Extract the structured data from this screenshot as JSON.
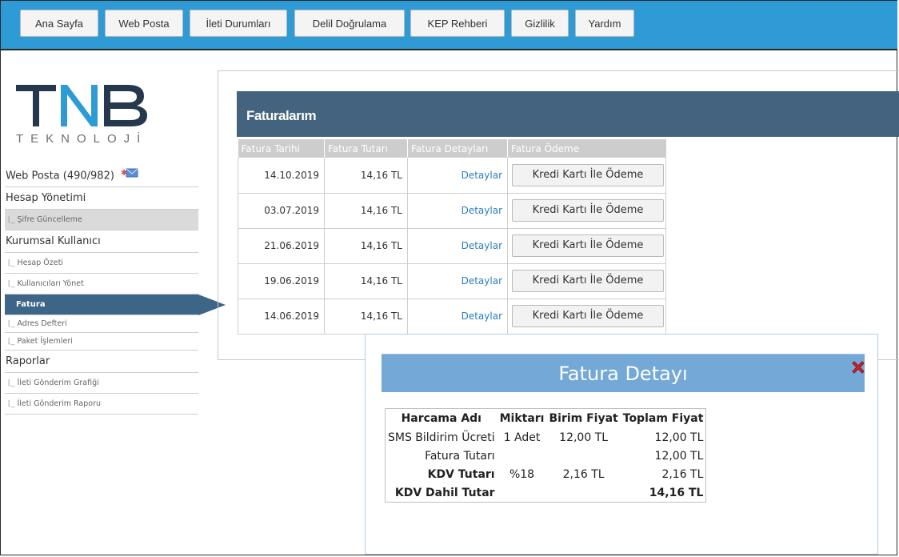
{
  "nav": {
    "items": [
      "Ana Sayfa",
      "Web Posta",
      "İleti Durumları",
      "Delil Doğrulama",
      "KEP Rehberi",
      "Gizlilik",
      "Yardım"
    ]
  },
  "logo": {
    "main": "TNB",
    "sub": "TEKNOLOJİ"
  },
  "sidebar": {
    "webposta": "Web Posta (490/982)",
    "hesap_yonetimi": "Hesap Yönetimi",
    "sifre": "Şifre Güncelleme",
    "kurumsal": "Kurumsal Kullanıcı",
    "hesap_ozeti": "Hesap Özeti",
    "kullanicilar": "Kullanıcıları Yönet",
    "fatura": "Fatura",
    "adres": "Adres Defteri",
    "paket": "Paket İşlemleri",
    "raporlar": "Raporlar",
    "grafik": "İleti Gönderim Grafiği",
    "rapor": "İleti Gönderim Raporu"
  },
  "invoices": {
    "title": "Faturalarım",
    "headers": [
      "Fatura Tarihi",
      "Fatura Tutarı",
      "Fatura Detayları",
      "Fatura Ödeme"
    ],
    "rows": [
      {
        "date": "14.10.2019",
        "amount": "14,16 TL",
        "details": "Detaylar",
        "pay": "Kredi Kartı İle Ödeme"
      },
      {
        "date": "03.07.2019",
        "amount": "14,16 TL",
        "details": "Detaylar",
        "pay": "Kredi Kartı İle Ödeme"
      },
      {
        "date": "21.06.2019",
        "amount": "14,16 TL",
        "details": "Detaylar",
        "pay": "Kredi Kartı İle Ödeme"
      },
      {
        "date": "19.06.2019",
        "amount": "14,16 TL",
        "details": "Detaylar",
        "pay": "Kredi Kartı İle Ödeme"
      },
      {
        "date": "14.06.2019",
        "amount": "14,16 TL",
        "details": "Detaylar",
        "pay": "Kredi Kartı İle Ödeme"
      }
    ]
  },
  "modal": {
    "title": "Fatura Detayı",
    "headers": [
      "Harcama Adı",
      "Miktarı",
      "Birim Fiyat",
      "Toplam Fiyat"
    ],
    "rows": [
      {
        "name": "SMS Bildirim Ücreti",
        "qty": "1 Adet",
        "unit": "12,00 TL",
        "total": "12,00 TL"
      },
      {
        "name": "Fatura Tutarı",
        "qty": "",
        "unit": "",
        "total": "12,00 TL"
      },
      {
        "name": "KDV Tutarı",
        "qty": "%18",
        "unit": "2,16 TL",
        "total": "2,16 TL"
      },
      {
        "name": "KDV Dahil Tutar",
        "qty": "",
        "unit": "",
        "total": "14,16 TL"
      }
    ]
  },
  "colors": {
    "topbar": "#2e9ad6",
    "panel_header": "#43637e",
    "modal_header": "#74a8d6",
    "link": "#2a7ec4"
  }
}
